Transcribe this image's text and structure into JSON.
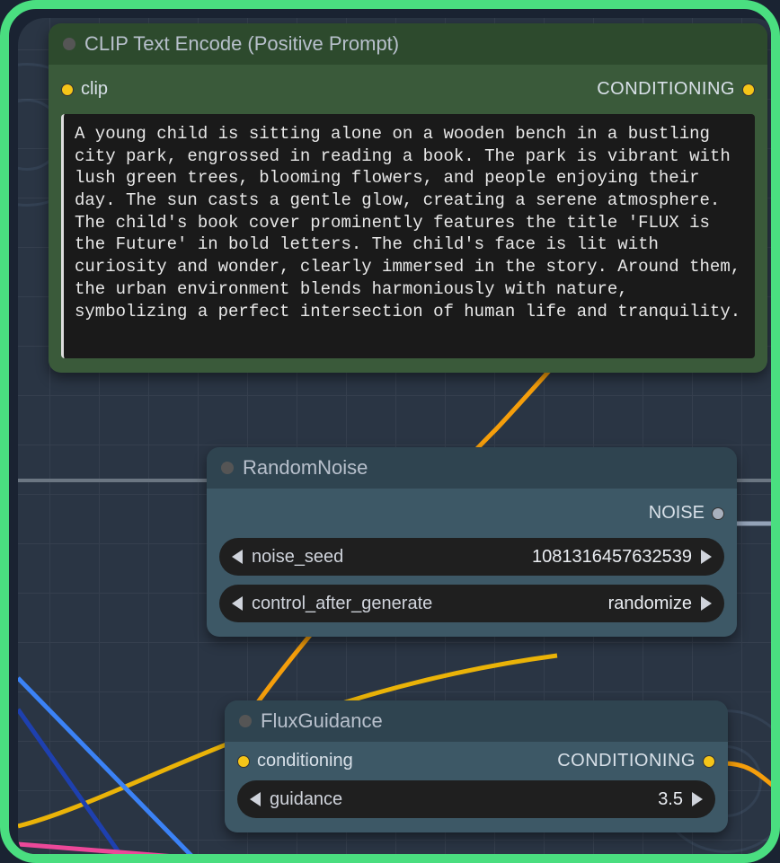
{
  "nodes": {
    "clip_text_encode": {
      "title": "CLIP Text Encode (Positive Prompt)",
      "input_label": "clip",
      "output_label": "CONDITIONING",
      "prompt_text": "A young child is sitting alone on a wooden bench in a bustling city park, engrossed in reading a book. The park is vibrant with lush green trees, blooming flowers, and people enjoying their day. The sun casts a gentle glow, creating a serene atmosphere. The child's book cover prominently features the title 'FLUX is the Future' in bold letters. The child's face is lit with curiosity and wonder, clearly immersed in the story. Around them, the urban environment blends harmoniously with nature, symbolizing a perfect intersection of human life and tranquility."
    },
    "random_noise": {
      "title": "RandomNoise",
      "output_label": "NOISE",
      "params": {
        "seed_label": "noise_seed",
        "seed_value": "1081316457632539",
        "control_label": "control_after_generate",
        "control_value": "randomize"
      }
    },
    "flux_guidance": {
      "title": "FluxGuidance",
      "input_label": "conditioning",
      "output_label": "CONDITIONING",
      "params": {
        "guidance_label": "guidance",
        "guidance_value": "3.5"
      }
    }
  },
  "colors": {
    "wire_orange": "#f59e0b",
    "wire_blue": "#3b82f6",
    "wire_yellow": "#eab308",
    "wire_pink": "#ec4899",
    "wire_gray": "#94a3b8"
  }
}
